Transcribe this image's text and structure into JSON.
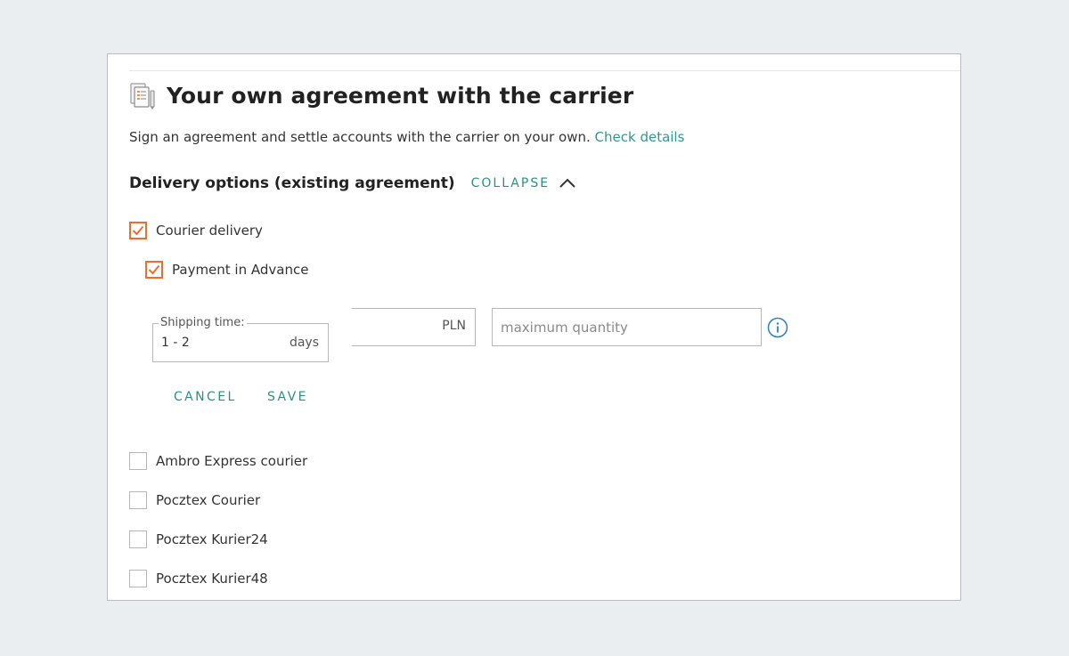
{
  "header": {
    "title": "Your own agreement with the carrier",
    "icon": "document-settings-icon"
  },
  "description": {
    "text": "Sign an agreement and settle accounts with the carrier on your own.",
    "link_text": "Check details"
  },
  "delivery_section": {
    "title": "Delivery options (existing agreement)",
    "collapse_label": "COLLAPSE"
  },
  "options": {
    "courier_delivery": {
      "label": "Courier delivery",
      "checked": true
    },
    "payment_in_advance": {
      "label": "Payment in Advance",
      "checked": true
    }
  },
  "form": {
    "shipping_time_label": "Shipping time:",
    "shipping_time_value": "1 - 2",
    "shipping_time_unit": "days",
    "price_unit": "PLN",
    "max_quantity_placeholder": "maximum quantity",
    "cancel_label": "CANCEL",
    "save_label": "SAVE"
  },
  "carriers": [
    {
      "label": "Ambro Express courier",
      "checked": false
    },
    {
      "label": "Pocztex Courier",
      "checked": false
    },
    {
      "label": "Pocztex Kurier24",
      "checked": false
    },
    {
      "label": "Pocztex Kurier48",
      "checked": false
    }
  ],
  "colors": {
    "accent": "#2e8f83",
    "checkbox_checked": "#f06c2b",
    "info_icon": "#2a7fc1",
    "background": "#ebeef1"
  }
}
